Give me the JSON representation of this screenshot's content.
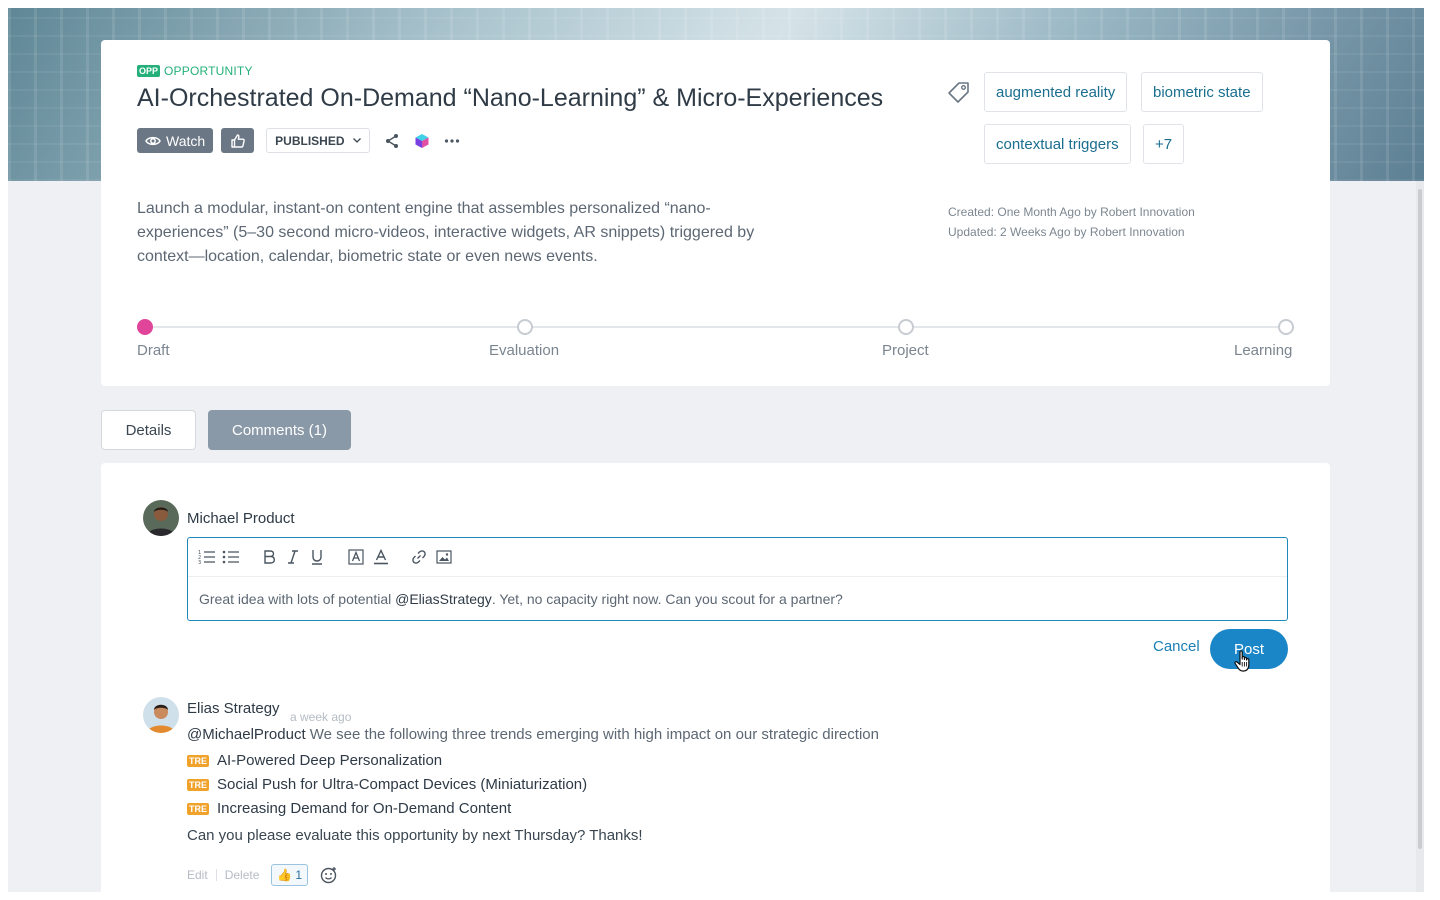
{
  "header": {
    "type_badge": "OPP",
    "type_label": "OPPORTUNITY",
    "title": "AI-Orchestrated On-Demand “Nano-Learning” & Micro-Experiences"
  },
  "actions": {
    "watch_label": "Watch",
    "status_label": "PUBLISHED"
  },
  "tags": {
    "items": [
      "augmented reality",
      "biometric state",
      "contextual triggers"
    ],
    "more_label": "+7"
  },
  "description": "Launch a modular, instant-on content engine that assembles personalized “nano-experiences” (5–30 second micro-videos, interactive widgets, AR snippets) triggered by context—location, calendar, biometric state or even news events.",
  "meta": {
    "created": "Created: One Month Ago by Robert Innovation",
    "updated": "Updated: 2 Weeks Ago by Robert Innovation"
  },
  "stages": {
    "items": [
      "Draft",
      "Evaluation",
      "Project",
      "Learning"
    ],
    "active_index": 0,
    "active_color": "#e0459a"
  },
  "tabs": {
    "details_label": "Details",
    "comments_label": "Comments (1)"
  },
  "composer": {
    "author": "Michael Product",
    "text_before": "Great idea with lots of potential ",
    "mention": "@EliasStrategy",
    "text_after": ". Yet, no capacity right now. Can you scout for a partner?",
    "cancel_label": "Cancel",
    "post_label": "Post"
  },
  "comment": {
    "author": "Elias Strategy",
    "time": "a week ago",
    "mention": "@MichaelProduct",
    "intro": " We see the following three trends emerging with high impact on our strategic direction",
    "trend_badge": "TRE",
    "trends": [
      "AI-Powered Deep Personalization",
      "Social Push for Ultra-Compact Devices (Miniaturization)",
      "Increasing Demand for On-Demand Content"
    ],
    "closing": "Can you please evaluate this opportunity by next Thursday? Thanks!",
    "edit_label": "Edit",
    "delete_label": "Delete",
    "reaction_emoji": "👍",
    "reaction_count": "1"
  },
  "colors": {
    "accent": "#1a86c7",
    "opportunity": "#25b07a",
    "trend": "#f0a22b"
  }
}
